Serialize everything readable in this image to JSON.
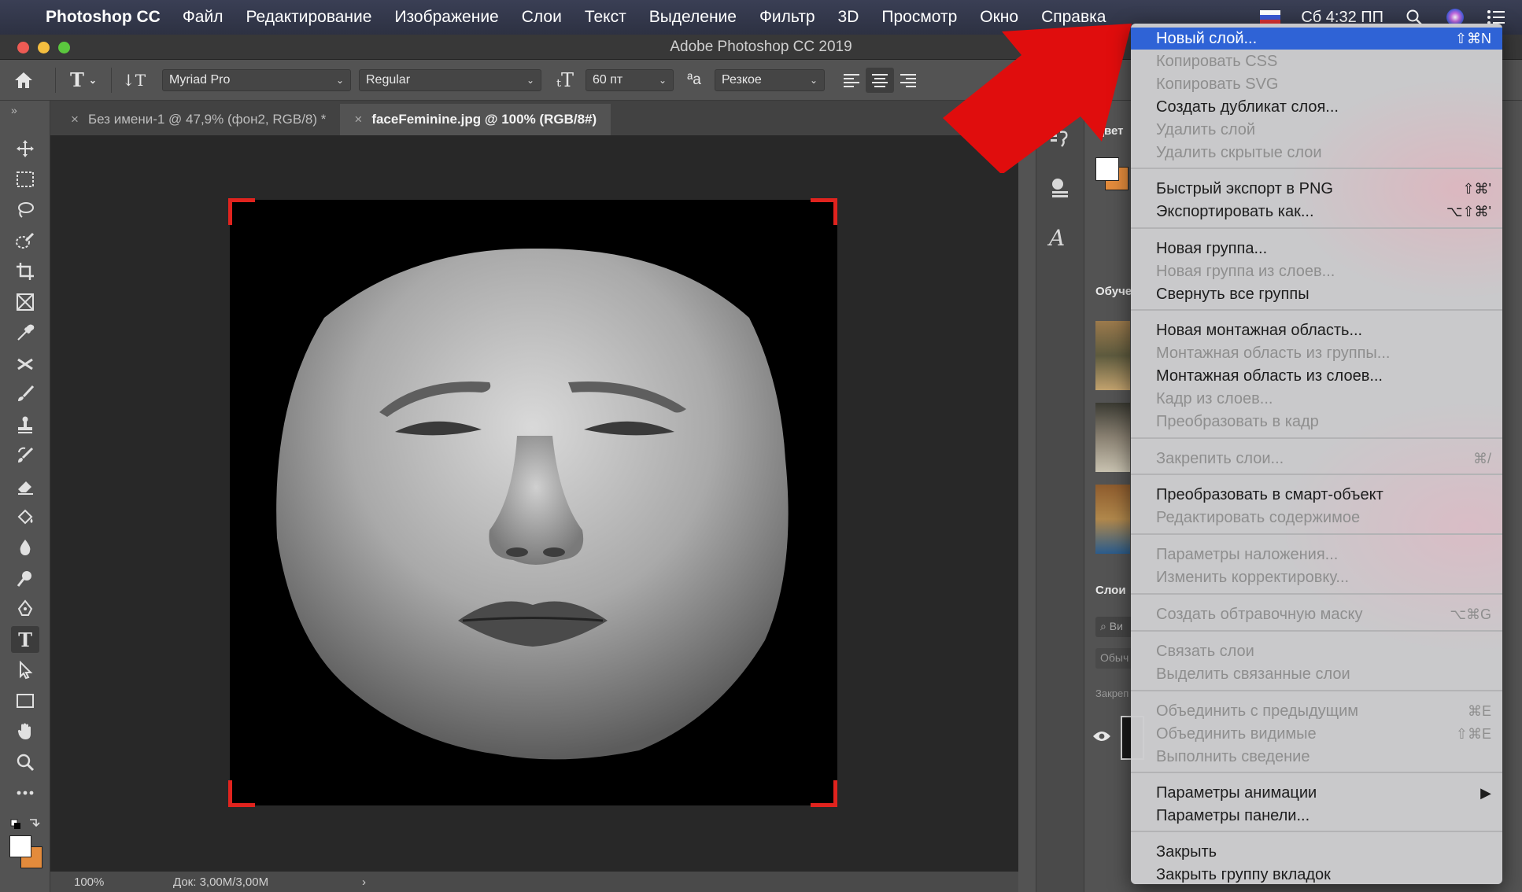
{
  "menubar": {
    "app_name": "Photoshop CC",
    "items": [
      "Файл",
      "Редактирование",
      "Изображение",
      "Слои",
      "Текст",
      "Выделение",
      "Фильтр",
      "3D",
      "Просмотр",
      "Окно",
      "Справка"
    ],
    "clock": "Сб 4:32 ПП"
  },
  "window": {
    "title": "Adobe Photoshop CC 2019"
  },
  "options": {
    "font_family": "Myriad Pro",
    "font_style": "Regular",
    "font_size": "60 пт",
    "antialias": "Резкое"
  },
  "tabs": [
    {
      "label": "Без имени-1 @ 47,9% (фон2, RGB/8) *",
      "active": false
    },
    {
      "label": "faceFeminine.jpg @ 100% (RGB/8#)",
      "active": true
    }
  ],
  "status": {
    "zoom": "100%",
    "doc": "Док: 3,00M/3,00M"
  },
  "panels": {
    "color": "Цвет",
    "learn": "Обуче",
    "layers": "Слои",
    "search_ph": "Ви",
    "kind": "Обыч",
    "lock": "Закреп"
  },
  "layer_menu": {
    "items": [
      {
        "label": "Новый слой...",
        "shortcut": "⇧⌘N",
        "state": "highlight"
      },
      {
        "label": "Копировать CSS",
        "shortcut": "",
        "state": "disabled"
      },
      {
        "label": "Копировать SVG",
        "shortcut": "",
        "state": "disabled"
      },
      {
        "label": "Создать дубликат слоя...",
        "shortcut": "",
        "state": "enabled"
      },
      {
        "label": "Удалить слой",
        "shortcut": "",
        "state": "disabled"
      },
      {
        "label": "Удалить скрытые слои",
        "shortcut": "",
        "state": "disabled"
      },
      {
        "label": "Быстрый экспорт в PNG",
        "shortcut": "⇧⌘'",
        "state": "enabled"
      },
      {
        "label": "Экспортировать как...",
        "shortcut": "⌥⇧⌘'",
        "state": "enabled"
      },
      {
        "label": "Новая группа...",
        "shortcut": "",
        "state": "enabled"
      },
      {
        "label": "Новая группа из слоев...",
        "shortcut": "",
        "state": "disabled"
      },
      {
        "label": "Свернуть все группы",
        "shortcut": "",
        "state": "enabled"
      },
      {
        "label": "Новая монтажная область...",
        "shortcut": "",
        "state": "enabled"
      },
      {
        "label": "Монтажная область из группы...",
        "shortcut": "",
        "state": "disabled"
      },
      {
        "label": "Монтажная область из слоев...",
        "shortcut": "",
        "state": "enabled"
      },
      {
        "label": "Кадр из слоев...",
        "shortcut": "",
        "state": "disabled"
      },
      {
        "label": "Преобразовать в кадр",
        "shortcut": "",
        "state": "disabled"
      },
      {
        "label": "Закрепить слои...",
        "shortcut": "⌘/",
        "state": "disabled"
      },
      {
        "label": "Преобразовать в смарт-объект",
        "shortcut": "",
        "state": "enabled"
      },
      {
        "label": "Редактировать содержимое",
        "shortcut": "",
        "state": "disabled"
      },
      {
        "label": "Параметры наложения...",
        "shortcut": "",
        "state": "disabled"
      },
      {
        "label": "Изменить корректировку...",
        "shortcut": "",
        "state": "disabled"
      },
      {
        "label": "Создать обтравочную маску",
        "shortcut": "⌥⌘G",
        "state": "disabled"
      },
      {
        "label": "Связать слои",
        "shortcut": "",
        "state": "disabled"
      },
      {
        "label": "Выделить связанные слои",
        "shortcut": "",
        "state": "disabled"
      },
      {
        "label": "Объединить с предыдущим",
        "shortcut": "⌘E",
        "state": "disabled"
      },
      {
        "label": "Объединить видимые",
        "shortcut": "⇧⌘E",
        "state": "disabled"
      },
      {
        "label": "Выполнить сведение",
        "shortcut": "",
        "state": "disabled"
      },
      {
        "label": "Параметры анимации",
        "shortcut": "▶",
        "state": "enabled"
      },
      {
        "label": "Параметры панели...",
        "shortcut": "",
        "state": "enabled"
      },
      {
        "label": "Закрыть",
        "shortcut": "",
        "state": "enabled"
      },
      {
        "label": "Закрыть группу вкладок",
        "shortcut": "",
        "state": "enabled"
      }
    ]
  },
  "colors": {
    "highlight": "#2f63d6",
    "arrow": "#e00d0d",
    "foreground": "#ffffff",
    "background": "#e38b3c"
  }
}
